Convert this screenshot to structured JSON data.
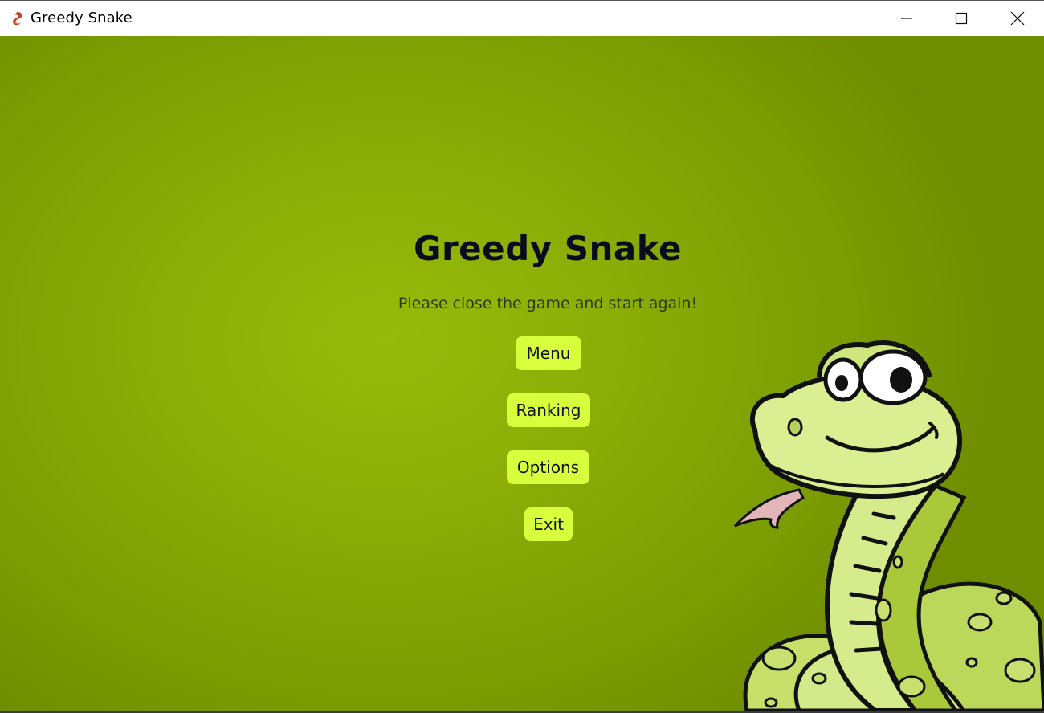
{
  "window": {
    "title": "Greedy Snake",
    "icon": "snake-app-icon",
    "controls": [
      "minimize-icon",
      "maximize-icon",
      "close-icon"
    ]
  },
  "game": {
    "title": "Greedy Snake",
    "message": "Please close the game and start again!",
    "buttons": {
      "menu": "Menu",
      "ranking": "Ranking",
      "options": "Options",
      "exit": "Exit"
    }
  },
  "colors": {
    "background": "#8aac06",
    "button": "#d8ff3b",
    "title_text": "#0b0b1e"
  }
}
